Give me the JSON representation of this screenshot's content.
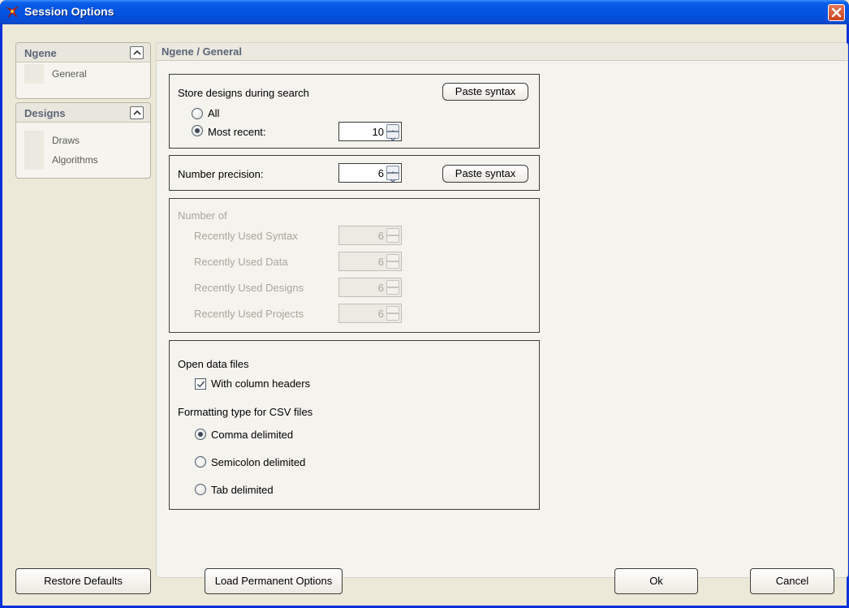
{
  "window": {
    "title": "Session Options",
    "title_color": "#ffffff",
    "titlebar_color": "#0454e2"
  },
  "nav": {
    "groups": [
      {
        "label": "Ngene",
        "items": [
          "General"
        ]
      },
      {
        "label": "Designs",
        "items": [
          "Draws",
          "Algorithms"
        ]
      }
    ]
  },
  "panel": {
    "header": "Ngene / General",
    "store": {
      "title": "Store designs during search",
      "paste_label": "Paste syntax",
      "option_all": "All",
      "option_recent": "Most recent:",
      "recent_value": "10",
      "selected": "Most recent:"
    },
    "precision": {
      "label": "Number precision:",
      "value": "6",
      "paste_label": "Paste syntax"
    },
    "number_of": {
      "title": "Number of",
      "rows": [
        {
          "label": "Recently Used Syntax",
          "value": "6"
        },
        {
          "label": "Recently Used Data",
          "value": "6"
        },
        {
          "label": "Recently Used Designs",
          "value": "6"
        },
        {
          "label": "Recently Used Projects",
          "value": "6"
        }
      ]
    },
    "data_files": {
      "title": "Open data files",
      "headers_label": "With column headers",
      "headers_checked": true,
      "csv_title": "Formatting type for CSV files",
      "csv_options": [
        "Comma delimited",
        "Semicolon delimited",
        "Tab delimited"
      ],
      "csv_selected": "Comma delimited"
    }
  },
  "buttons": {
    "restore": "Restore Defaults",
    "load": "Load Permanent Options",
    "ok": "Ok",
    "cancel": "Cancel"
  }
}
